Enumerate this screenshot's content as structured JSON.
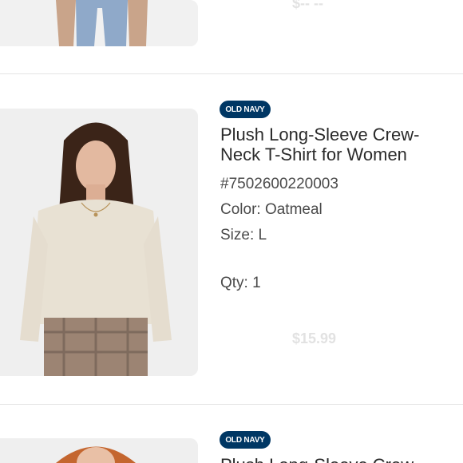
{
  "colors": {
    "brand_badge_bg": "#003764",
    "divider": "#e4e4e4"
  },
  "items": [
    {
      "image_alt": "jeans-product-photo",
      "faded_price": "$-- --"
    },
    {
      "image_alt": "woman-in-oatmeal-long-sleeve-shirt",
      "brand": "OLD NAVY",
      "title": "Plush Long-Sleeve Crew-\nNeck T-Shirt for Women",
      "sku": "#7502600220003",
      "color": "Color: Oatmeal",
      "size": "Size: L",
      "qty": "Qty: 1",
      "faded_price": "$15.99"
    },
    {
      "image_alt": "red-haired-woman-product-photo",
      "brand": "OLD NAVY",
      "title": "Plush Long-Sleeve Crew"
    }
  ]
}
